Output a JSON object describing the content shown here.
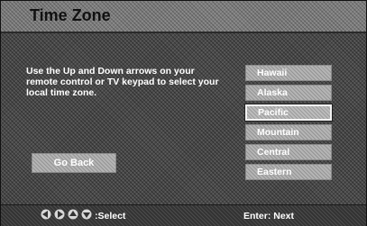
{
  "header": {
    "title": "Time Zone"
  },
  "main": {
    "instructions": "Use the Up and Down arrows on your remote control or TV keypad to select your local time zone.",
    "go_back_label": "Go Back",
    "zones": [
      {
        "label": "Hawaii",
        "selected": false
      },
      {
        "label": "Alaska",
        "selected": false
      },
      {
        "label": "Pacific",
        "selected": true
      },
      {
        "label": "Mountain",
        "selected": false
      },
      {
        "label": "Central",
        "selected": false
      },
      {
        "label": "Eastern",
        "selected": false
      }
    ]
  },
  "footer": {
    "nav_icons": [
      "arrow-left-icon",
      "arrow-right-icon",
      "arrow-up-icon",
      "arrow-down-icon"
    ],
    "select_label": ":Select",
    "enter_label": "Enter: Next"
  }
}
